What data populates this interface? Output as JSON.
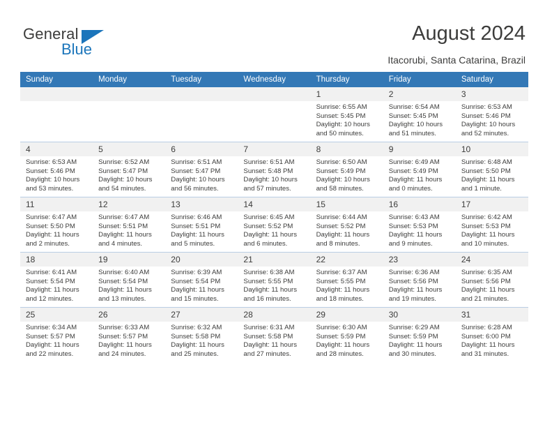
{
  "brand": {
    "name_top": "General",
    "name_bottom": "Blue",
    "color_text": "#3c3c3b",
    "color_accent": "#1b75bb"
  },
  "header": {
    "title": "August 2024",
    "subtitle": "Itacorubi, Santa Catarina, Brazil"
  },
  "calendar": {
    "header_bg": "#3378b6",
    "header_text_color": "#ffffff",
    "daynum_bg": "#f1f1f1",
    "grid_line": "#b9cde4",
    "weekdays": [
      "Sunday",
      "Monday",
      "Tuesday",
      "Wednesday",
      "Thursday",
      "Friday",
      "Saturday"
    ],
    "weeks": [
      [
        {
          "day": "",
          "empty": true
        },
        {
          "day": "",
          "empty": true
        },
        {
          "day": "",
          "empty": true
        },
        {
          "day": "",
          "empty": true
        },
        {
          "day": "1",
          "sunrise": "Sunrise: 6:55 AM",
          "sunset": "Sunset: 5:45 PM",
          "daylight_line1": "Daylight: 10 hours",
          "daylight_line2": "and 50 minutes."
        },
        {
          "day": "2",
          "sunrise": "Sunrise: 6:54 AM",
          "sunset": "Sunset: 5:45 PM",
          "daylight_line1": "Daylight: 10 hours",
          "daylight_line2": "and 51 minutes."
        },
        {
          "day": "3",
          "sunrise": "Sunrise: 6:53 AM",
          "sunset": "Sunset: 5:46 PM",
          "daylight_line1": "Daylight: 10 hours",
          "daylight_line2": "and 52 minutes."
        }
      ],
      [
        {
          "day": "4",
          "sunrise": "Sunrise: 6:53 AM",
          "sunset": "Sunset: 5:46 PM",
          "daylight_line1": "Daylight: 10 hours",
          "daylight_line2": "and 53 minutes."
        },
        {
          "day": "5",
          "sunrise": "Sunrise: 6:52 AM",
          "sunset": "Sunset: 5:47 PM",
          "daylight_line1": "Daylight: 10 hours",
          "daylight_line2": "and 54 minutes."
        },
        {
          "day": "6",
          "sunrise": "Sunrise: 6:51 AM",
          "sunset": "Sunset: 5:47 PM",
          "daylight_line1": "Daylight: 10 hours",
          "daylight_line2": "and 56 minutes."
        },
        {
          "day": "7",
          "sunrise": "Sunrise: 6:51 AM",
          "sunset": "Sunset: 5:48 PM",
          "daylight_line1": "Daylight: 10 hours",
          "daylight_line2": "and 57 minutes."
        },
        {
          "day": "8",
          "sunrise": "Sunrise: 6:50 AM",
          "sunset": "Sunset: 5:49 PM",
          "daylight_line1": "Daylight: 10 hours",
          "daylight_line2": "and 58 minutes."
        },
        {
          "day": "9",
          "sunrise": "Sunrise: 6:49 AM",
          "sunset": "Sunset: 5:49 PM",
          "daylight_line1": "Daylight: 11 hours",
          "daylight_line2": "and 0 minutes."
        },
        {
          "day": "10",
          "sunrise": "Sunrise: 6:48 AM",
          "sunset": "Sunset: 5:50 PM",
          "daylight_line1": "Daylight: 11 hours",
          "daylight_line2": "and 1 minute."
        }
      ],
      [
        {
          "day": "11",
          "sunrise": "Sunrise: 6:47 AM",
          "sunset": "Sunset: 5:50 PM",
          "daylight_line1": "Daylight: 11 hours",
          "daylight_line2": "and 2 minutes."
        },
        {
          "day": "12",
          "sunrise": "Sunrise: 6:47 AM",
          "sunset": "Sunset: 5:51 PM",
          "daylight_line1": "Daylight: 11 hours",
          "daylight_line2": "and 4 minutes."
        },
        {
          "day": "13",
          "sunrise": "Sunrise: 6:46 AM",
          "sunset": "Sunset: 5:51 PM",
          "daylight_line1": "Daylight: 11 hours",
          "daylight_line2": "and 5 minutes."
        },
        {
          "day": "14",
          "sunrise": "Sunrise: 6:45 AM",
          "sunset": "Sunset: 5:52 PM",
          "daylight_line1": "Daylight: 11 hours",
          "daylight_line2": "and 6 minutes."
        },
        {
          "day": "15",
          "sunrise": "Sunrise: 6:44 AM",
          "sunset": "Sunset: 5:52 PM",
          "daylight_line1": "Daylight: 11 hours",
          "daylight_line2": "and 8 minutes."
        },
        {
          "day": "16",
          "sunrise": "Sunrise: 6:43 AM",
          "sunset": "Sunset: 5:53 PM",
          "daylight_line1": "Daylight: 11 hours",
          "daylight_line2": "and 9 minutes."
        },
        {
          "day": "17",
          "sunrise": "Sunrise: 6:42 AM",
          "sunset": "Sunset: 5:53 PM",
          "daylight_line1": "Daylight: 11 hours",
          "daylight_line2": "and 10 minutes."
        }
      ],
      [
        {
          "day": "18",
          "sunrise": "Sunrise: 6:41 AM",
          "sunset": "Sunset: 5:54 PM",
          "daylight_line1": "Daylight: 11 hours",
          "daylight_line2": "and 12 minutes."
        },
        {
          "day": "19",
          "sunrise": "Sunrise: 6:40 AM",
          "sunset": "Sunset: 5:54 PM",
          "daylight_line1": "Daylight: 11 hours",
          "daylight_line2": "and 13 minutes."
        },
        {
          "day": "20",
          "sunrise": "Sunrise: 6:39 AM",
          "sunset": "Sunset: 5:54 PM",
          "daylight_line1": "Daylight: 11 hours",
          "daylight_line2": "and 15 minutes."
        },
        {
          "day": "21",
          "sunrise": "Sunrise: 6:38 AM",
          "sunset": "Sunset: 5:55 PM",
          "daylight_line1": "Daylight: 11 hours",
          "daylight_line2": "and 16 minutes."
        },
        {
          "day": "22",
          "sunrise": "Sunrise: 6:37 AM",
          "sunset": "Sunset: 5:55 PM",
          "daylight_line1": "Daylight: 11 hours",
          "daylight_line2": "and 18 minutes."
        },
        {
          "day": "23",
          "sunrise": "Sunrise: 6:36 AM",
          "sunset": "Sunset: 5:56 PM",
          "daylight_line1": "Daylight: 11 hours",
          "daylight_line2": "and 19 minutes."
        },
        {
          "day": "24",
          "sunrise": "Sunrise: 6:35 AM",
          "sunset": "Sunset: 5:56 PM",
          "daylight_line1": "Daylight: 11 hours",
          "daylight_line2": "and 21 minutes."
        }
      ],
      [
        {
          "day": "25",
          "sunrise": "Sunrise: 6:34 AM",
          "sunset": "Sunset: 5:57 PM",
          "daylight_line1": "Daylight: 11 hours",
          "daylight_line2": "and 22 minutes."
        },
        {
          "day": "26",
          "sunrise": "Sunrise: 6:33 AM",
          "sunset": "Sunset: 5:57 PM",
          "daylight_line1": "Daylight: 11 hours",
          "daylight_line2": "and 24 minutes."
        },
        {
          "day": "27",
          "sunrise": "Sunrise: 6:32 AM",
          "sunset": "Sunset: 5:58 PM",
          "daylight_line1": "Daylight: 11 hours",
          "daylight_line2": "and 25 minutes."
        },
        {
          "day": "28",
          "sunrise": "Sunrise: 6:31 AM",
          "sunset": "Sunset: 5:58 PM",
          "daylight_line1": "Daylight: 11 hours",
          "daylight_line2": "and 27 minutes."
        },
        {
          "day": "29",
          "sunrise": "Sunrise: 6:30 AM",
          "sunset": "Sunset: 5:59 PM",
          "daylight_line1": "Daylight: 11 hours",
          "daylight_line2": "and 28 minutes."
        },
        {
          "day": "30",
          "sunrise": "Sunrise: 6:29 AM",
          "sunset": "Sunset: 5:59 PM",
          "daylight_line1": "Daylight: 11 hours",
          "daylight_line2": "and 30 minutes."
        },
        {
          "day": "31",
          "sunrise": "Sunrise: 6:28 AM",
          "sunset": "Sunset: 6:00 PM",
          "daylight_line1": "Daylight: 11 hours",
          "daylight_line2": "and 31 minutes."
        }
      ]
    ]
  }
}
